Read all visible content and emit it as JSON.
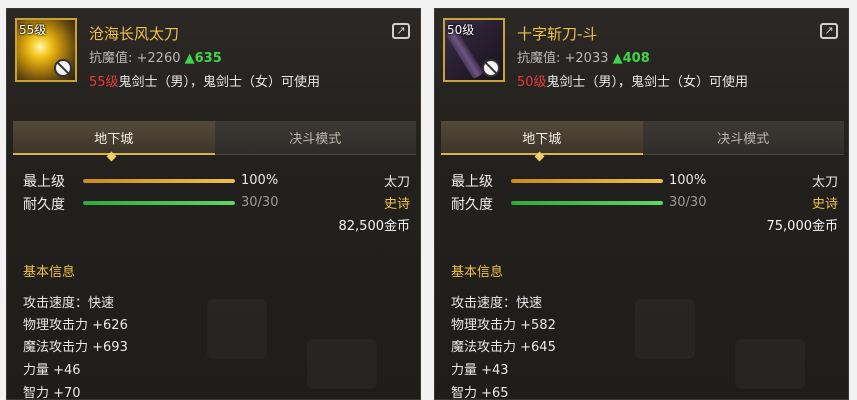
{
  "left": {
    "level_badge": "55级",
    "name": "沧海长风太刀",
    "resist_label": "抗魔值: +2260",
    "resist_up": "▲635",
    "req_level": "55级",
    "usable_text": "鬼剑士（男），鬼剑士（女）可使用",
    "tab_dungeon": "地下城",
    "tab_duel": "决斗模式",
    "max_level_label": "最上级",
    "max_level_value": "100%",
    "max_level_fraction": 1.0,
    "durability_label": "耐久度",
    "durability_value": "30/30",
    "durability_fraction": 1.0,
    "weapon_type": "太刀",
    "rarity": "史诗",
    "price": "82,500金币",
    "section_title": "基本信息",
    "info": [
      "攻击速度：快速",
      "物理攻击力 +626",
      "魔法攻击力 +693",
      "力量 +46",
      "智力 +70"
    ]
  },
  "right": {
    "level_badge": "50级",
    "name": "十字斩刀-斗",
    "resist_label": "抗魔值: +2033",
    "resist_up": "▲408",
    "req_level": "50级",
    "usable_text": "鬼剑士（男），鬼剑士（女）可使用",
    "tab_dungeon": "地下城",
    "tab_duel": "决斗模式",
    "max_level_label": "最上级",
    "max_level_value": "100%",
    "max_level_fraction": 1.0,
    "durability_label": "耐久度",
    "durability_value": "30/30",
    "durability_fraction": 1.0,
    "weapon_type": "太刀",
    "rarity": "史诗",
    "price": "75,000金币",
    "section_title": "基本信息",
    "info": [
      "攻击速度：快速",
      "物理攻击力 +582",
      "魔法攻击力 +645",
      "力量 +43",
      "智力 +65"
    ]
  },
  "colors": {
    "name_gold": "#f0c24a",
    "rarity_gold": "#f0c24a",
    "resist_up_green": "#3fd64a",
    "req_red": "#e23c3c",
    "border_gold": "#c9a238"
  },
  "icons": {
    "share": "share-icon",
    "unusable": "no-entry-icon"
  }
}
